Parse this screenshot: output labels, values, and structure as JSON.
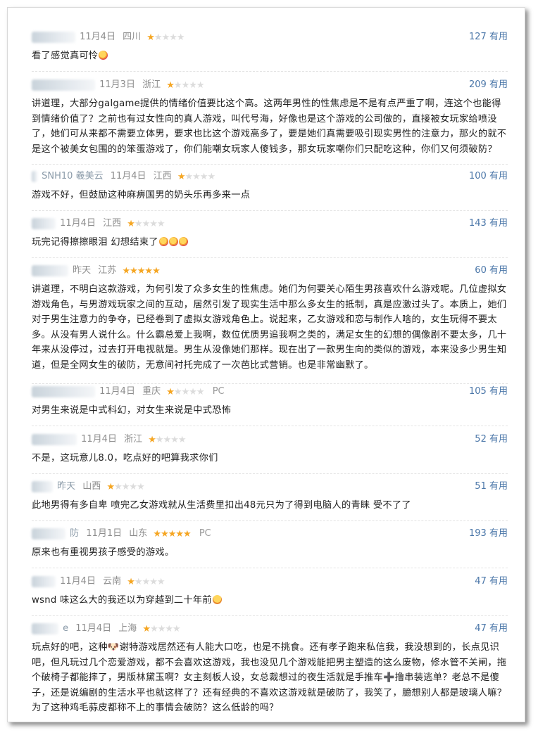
{
  "useful_label": "有用",
  "reviews": [
    {
      "name_tail": "",
      "date": "11月4日",
      "location": "四川",
      "stars": 1,
      "platform": "",
      "useful": "127",
      "text": "看了感觉真可怜",
      "emoji": "🤣"
    },
    {
      "name_tail": "",
      "date": "11月3日",
      "location": "浙江",
      "stars": 1,
      "platform": "",
      "useful": "209",
      "text": "讲道理，大部分galgame提供的情绪价值要比这个高。这两年男性的性焦虑是不是有点严重了啊，连这个也能得到情绪价值了？之前也有过女性向的真人游戏，叫代号海，好像也是这个游戏的公司做的，直接被女玩家给喷没了，她们可从来都不需要立体男，要求也比这个游戏高多了，要是她们真需要吸引现实男性的注意力，那火的就不是这个被美女包围的的笨蛋游戏了，你们能嘲女玩家人傻钱多，那女玩家嘲你们只配吃这种，你们又何须破防？",
      "emoji": ""
    },
    {
      "name_tail": "SNH10 羲美云",
      "date": "11月4日",
      "location": "江西",
      "stars": 1,
      "platform": "",
      "useful": "100",
      "text": "游戏不好，但鼓励这种麻痹国男的奶头乐再多来一点",
      "emoji": ""
    },
    {
      "name_tail": "",
      "date": "11月4日",
      "location": "江西",
      "stars": 1,
      "platform": "",
      "useful": "143",
      "text": "玩完记得擦擦眼泪 幻想结束了",
      "emoji": "🤣🤣🤣"
    },
    {
      "name_tail": "",
      "date": "昨天",
      "location": "江苏",
      "stars": 5,
      "platform": "",
      "useful": "60",
      "text": "讲道理，不明白这款游戏，为何引发了众多女生的性焦虑。她们为何要关心陌生男孩喜欢什么游戏呢。几位虚拟女游戏角色，与男游戏玩家之间的互动，居然引发了现实生活中那么多女生的抵制，真是应激过头了。本质上，她们对于男生注意力的争夺，已经卷到了虚拟女游戏角色上。说起来，乙女游戏和恋与制作人啥的，女生玩得不要太多。从没有男人说什么。什么霸总爱上我啊，数位优质男追我啊之类的，满足女生的幻想的偶像剧不要太多，几十年来从没停过，过去打开电视就是。男生从没像她们那样。现在出了一款男生向的类似的游戏，本来没多少男生知道，但是全网女生的破防，无意间衬托完成了一次芭比式营销。也是非常幽默了。",
      "emoji": ""
    },
    {
      "name_tail": "",
      "date": "11月4日",
      "location": "重庆",
      "stars": 1,
      "platform": "PC",
      "useful": "105",
      "text": "对男生来说是中式科幻，对女生来说是中式恐怖",
      "emoji": ""
    },
    {
      "name_tail": "",
      "date": "11月4日",
      "location": "浙江",
      "stars": 1,
      "platform": "",
      "useful": "52",
      "text": "不是，这玩意儿8.0，吃点好的吧算我求你们",
      "emoji": ""
    },
    {
      "name_tail": "昨天",
      "date": "",
      "location": "山西",
      "stars": 1,
      "platform": "",
      "useful": "51",
      "text": "此地男得有多自卑 喷完乙女游戏就从生活费里扣出48元只为了得到电脑人的青睐 受不了了",
      "emoji": ""
    },
    {
      "name_tail": "防",
      "date": "11月1日",
      "location": "山东",
      "stars": 5,
      "platform": "PC",
      "useful": "193",
      "text": "原来也有重视男孩子感受的游戏。",
      "emoji": ""
    },
    {
      "name_tail": "",
      "date": "11月4日",
      "location": "云南",
      "stars": 1,
      "platform": "",
      "useful": "47",
      "text": "wsnd 味这么大的我还以为穿越到二十年前",
      "emoji": "😂"
    },
    {
      "name_tail": "e",
      "date": "11月4日",
      "location": "上海",
      "stars": 1,
      "platform": "",
      "useful": "47",
      "text": "玩点好的吧，这种🐶谢特游戏居然还有人能大口吃，也是不挑食。还有孝子跑来私信我，我没想到的，长点见识吧，但凡玩过几个恋爱游戏，都不会喜欢这游戏，我也没见几个游戏能把男主塑造的这么废物，修水管不关闸，拖个破椅子都能摔了，男版林黛玉啊？女主刻板人设，女总裁想过的夜生活就是手推车➕撸串装逃单？老总不是傻子，还是说编剧的生活水平也就这样了？还有经典的不喜欢这游戏就是破防了，我笑了，臆想别人都是玻璃人嘛？为了这种鸡毛蒜皮都称不上的事情会破防？这么低龄的吗？",
      "emoji": ""
    }
  ]
}
